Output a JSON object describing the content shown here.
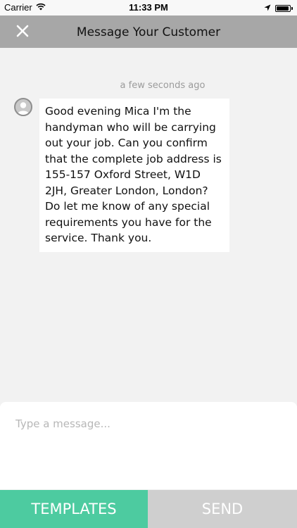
{
  "status_bar": {
    "carrier": "Carrier",
    "time": "11:33 PM",
    "icons": [
      "wifi-icon",
      "location-arrow-icon",
      "battery-icon"
    ],
    "battery_level": 0.95
  },
  "header": {
    "title": "Message Your Customer",
    "close_icon": "close-icon",
    "background_color": "#a7a7a7"
  },
  "messages": [
    {
      "timestamp": "a few seconds ago",
      "avatar_icon": "user-avatar-icon",
      "text": "Good evening Mica I'm the handyman who will be carrying out your job. Can you confirm that the complete job address is 155-157 Oxford Street, W1D 2JH, Greater London, London? Do let me know of any special requirements you have for the service. Thank you."
    }
  ],
  "composer": {
    "placeholder": "Type a message...",
    "value": ""
  },
  "actions": {
    "templates_label": "TEMPLATES",
    "send_label": "SEND",
    "templates_color": "#4dcba0",
    "send_color": "#cfcfcf"
  }
}
